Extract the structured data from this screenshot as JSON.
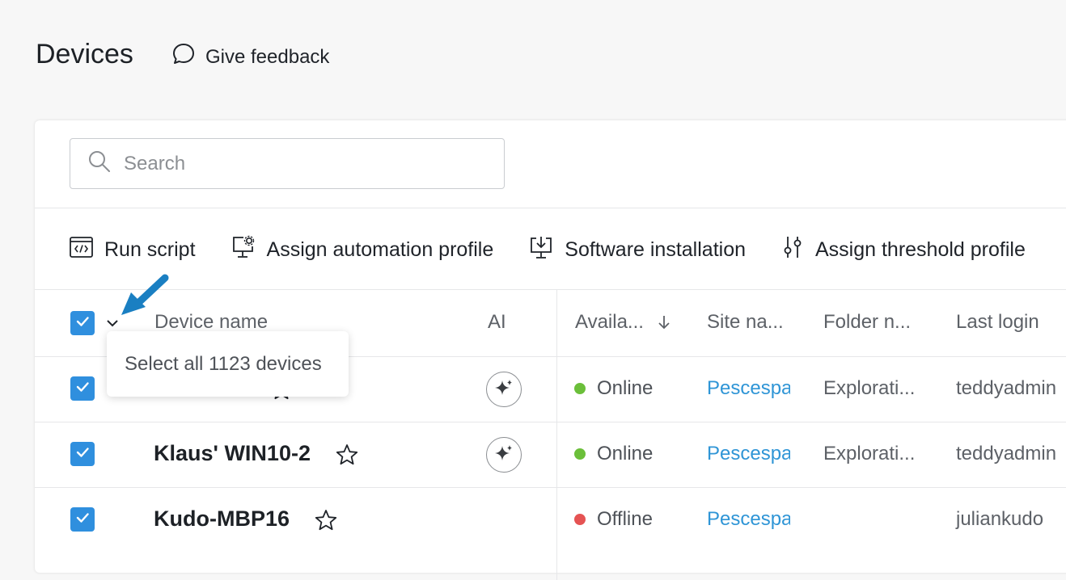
{
  "header": {
    "title": "Devices",
    "feedback_label": "Give feedback"
  },
  "search": {
    "placeholder": "Search"
  },
  "toolbar": {
    "run_script": "Run script",
    "assign_automation_profile": "Assign automation profile",
    "software_installation": "Software installation",
    "assign_threshold_profile": "Assign threshold profile"
  },
  "table": {
    "columns": {
      "device_name": "Device name",
      "ai": "AI",
      "availability": "Availa...",
      "site_name": "Site na...",
      "folder_name": "Folder n...",
      "last_login": "Last login"
    },
    "select_all_tooltip": "Select all 1123 devices",
    "rows": [
      {
        "name": "",
        "status": "Online",
        "site": "Pescespada",
        "folder": "Explorati...",
        "last_login": "teddyadmin",
        "has_ai": true,
        "selected": true
      },
      {
        "name": "Klaus' WIN10-2",
        "status": "Online",
        "site": "Pescespada",
        "folder": "Explorati...",
        "last_login": "teddyadmin",
        "has_ai": true,
        "selected": true
      },
      {
        "name": "Kudo-MBP16",
        "status": "Offline",
        "site": "Pescespada",
        "folder": "",
        "last_login": "juliankudo",
        "has_ai": false,
        "selected": true
      }
    ]
  },
  "colors": {
    "accent": "#2f8fde",
    "online": "#6bbf3a",
    "offline": "#e55353",
    "link": "#2f95d6"
  }
}
